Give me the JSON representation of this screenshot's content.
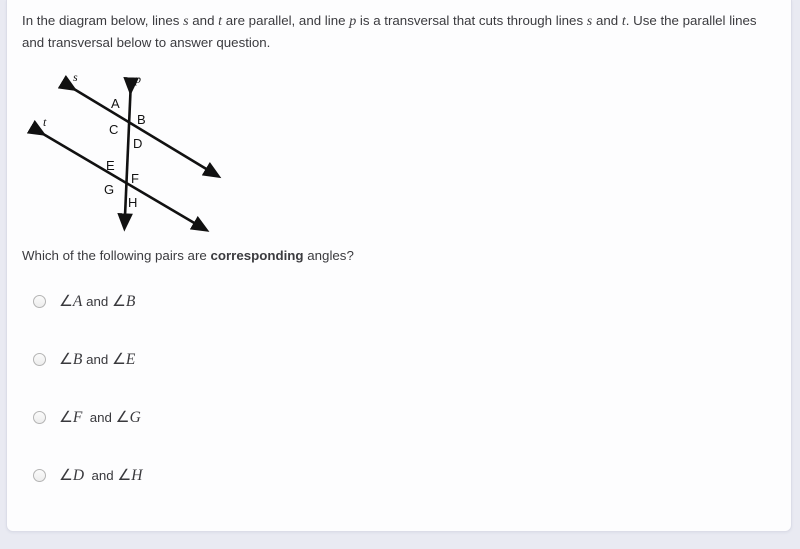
{
  "prompt": {
    "part1": "In the diagram below, lines ",
    "var_s": "s",
    "part2": " and ",
    "var_t": "t",
    "part3": " are parallel, and line ",
    "var_p": "p",
    "part4": " is a transversal that cuts through lines ",
    "var_s2": "s",
    "part5": " and ",
    "var_t2": "t",
    "part6": ".  Use the parallel lines and transversal below to answer question."
  },
  "diagram": {
    "line_labels": {
      "s": "s",
      "t": "t",
      "p": "p"
    },
    "angle_labels": {
      "A": "A",
      "B": "B",
      "C": "C",
      "D": "D",
      "E": "E",
      "F": "F",
      "G": "G",
      "H": "H"
    },
    "stroke_color": "#111111"
  },
  "question": {
    "before": "Which of the following pairs are ",
    "emphasis": "corresponding",
    "after": " angles?"
  },
  "options": [
    {
      "id": "option-a",
      "symbol1": "∠",
      "letter1": "A",
      "conjunction": " and ",
      "symbol2": "∠",
      "letter2": "B",
      "selected": false
    },
    {
      "id": "option-b",
      "symbol1": "∠",
      "letter1": "B",
      "conjunction": " and ",
      "symbol2": "∠",
      "letter2": "E",
      "selected": false
    },
    {
      "id": "option-c",
      "symbol1": "∠",
      "letter1": "F",
      "conjunction": "  and ",
      "symbol2": "∠",
      "letter2": "G",
      "selected": false
    },
    {
      "id": "option-d",
      "symbol1": "∠",
      "letter1": "D",
      "conjunction": "  and ",
      "symbol2": "∠",
      "letter2": "H",
      "selected": false
    }
  ]
}
